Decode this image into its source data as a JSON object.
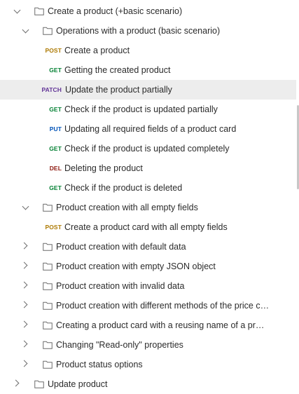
{
  "tree": {
    "root": {
      "label": "Create a product (+basic scenario)",
      "expanded": true,
      "icon": "folder-icon"
    },
    "basic_folder": {
      "label": "Operations with a product (basic scenario)",
      "expanded": true,
      "icon": "folder-icon",
      "requests": [
        {
          "method": "POST",
          "label": "Create a product"
        },
        {
          "method": "GET",
          "label": "Getting the created product"
        },
        {
          "method": "PATCH",
          "label": "Update the product partially",
          "selected": true
        },
        {
          "method": "GET",
          "label": "Check if the product is updated partially"
        },
        {
          "method": "PUT",
          "label": "Updating all required fields of a product card"
        },
        {
          "method": "GET",
          "label": "Check if the product is updated completely"
        },
        {
          "method": "DEL",
          "label": "Deleting the product"
        },
        {
          "method": "GET",
          "label": "Check if the product is deleted"
        }
      ]
    },
    "empty_fields_folder": {
      "label": "Product creation with all empty fields",
      "expanded": true,
      "icon": "folder-icon",
      "requests": [
        {
          "method": "POST",
          "label": "Create a product card with all empty fields"
        }
      ]
    },
    "collapsed_folders": [
      {
        "label": "Product creation with default data",
        "expanded": false
      },
      {
        "label": "Product creation with empty JSON object",
        "expanded": false
      },
      {
        "label": "Product creation with invalid data",
        "expanded": false
      },
      {
        "label": "Product creation with different methods of the price calculation",
        "expanded": false
      },
      {
        "label": "Creating a product card with a reusing name of a product",
        "expanded": false
      },
      {
        "label": "Changing \"Read-only\" properties",
        "expanded": false
      },
      {
        "label": "Product status options",
        "expanded": false
      }
    ],
    "partial_next": {
      "label": "Update product"
    }
  },
  "colors": {
    "POST": "#ad7a03",
    "GET": "#007f31",
    "PATCH": "#623497",
    "PUT": "#0053b8",
    "DEL": "#8e1a10",
    "selected_row": "#ededed"
  }
}
